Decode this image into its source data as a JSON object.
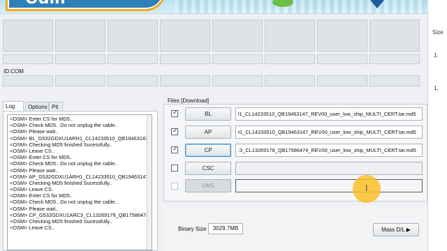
{
  "banner": {
    "logo_text": "Odin",
    "colors": {
      "logo_blue": "#2f7fb8",
      "logo_border": "#f5a91a",
      "sky": "#c7e7f2"
    }
  },
  "right_panel": {
    "size_header": "Size",
    "row1": "1.",
    "row2": "1,"
  },
  "ports": {
    "id_com_label": "ID:COM"
  },
  "log_tabs": [
    {
      "label": "Log",
      "active": true
    },
    {
      "label": "Options",
      "active": false
    },
    {
      "label": "Pit",
      "active": false
    }
  ],
  "log_lines": [
    "<OSM> Enter CS for MD5..",
    "<OSM> Check MD5.. Do not unplug the cable..",
    "<OSM> Please wait..",
    "<OSM> BL_G532GDXU1ARH1_CL14233510_QB19463147_",
    "<OSM> Checking MD5 finished Sucessfully..",
    "<OSM> Leave CS..",
    "<OSM> Enter CS for MD5..",
    "<OSM> Check MD5.. Do not unplug the cable..",
    "<OSM> Please wait..",
    "<OSM> AP_G532GDXU1ARH1_CL14233510_QB19463147_",
    "<OSM> Checking MD5 finished Sucessfully..",
    "<OSM> Leave CS..",
    "<OSM> Enter CS for MD5..",
    "<OSM> Check MD5.. Do not unplug the cable..",
    "<OSM> Please wait..",
    "<OSM> CP_G532GDXU1ARC3_CL13269178_QB17586474",
    "<OSM> Checking MD5 finished Sucessfully..",
    "<OSM> Leave CS.."
  ],
  "files": {
    "title": "Files [Download]",
    "rows": [
      {
        "label": "BL",
        "checked": true,
        "path": "l1_CL14233510_QB19463147_REV00_user_low_ship_MULTI_CERT.tar.md5"
      },
      {
        "label": "AP",
        "checked": true,
        "path": "t1_CL14233510_QB19463147_REV00_user_low_ship_MULTI_CERT.tar.md5"
      },
      {
        "label": "CP",
        "checked": true,
        "path": ":3_CL13269178_QB17586474_REV00_user_low_ship_MULTI_CERT.tar.md5"
      },
      {
        "label": "CSC",
        "checked": false,
        "path": ""
      },
      {
        "label": "UMS",
        "checked": false,
        "path": ""
      }
    ]
  },
  "bottom": {
    "binary_size_label": "Binary Size",
    "binary_size_value": "3029.7MB",
    "mass_dl_label": "Mass D/L ▶"
  }
}
